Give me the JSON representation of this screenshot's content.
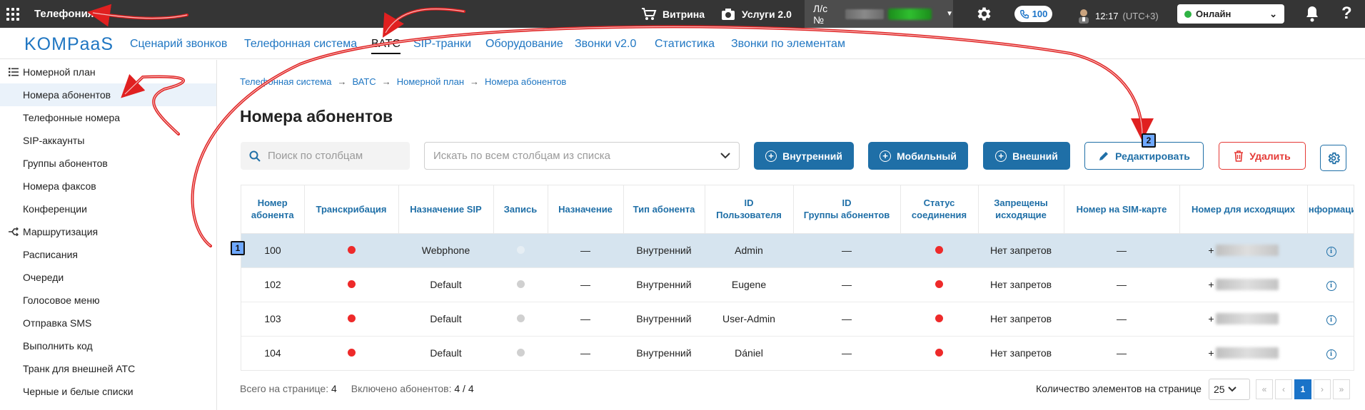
{
  "topbar": {
    "app_title": "Телефония",
    "showcase": "Витрина",
    "services": "Услуги 2.0",
    "account_label": "Л/с №",
    "phone_count": "100",
    "time": "12:17",
    "timezone": "(UTC+3)",
    "status": "Онлайн",
    "help": "?"
  },
  "nav": {
    "logo": "KOMPaaS",
    "tabs": [
      "Сценарий звонков",
      "Телефонная система",
      "ВАТС",
      "SIP-транки",
      "Оборудование",
      "Звонки v2.0",
      "Статистика",
      "Звонки по элементам"
    ]
  },
  "sidebar": {
    "items": [
      "Номерной план",
      "Номера абонентов",
      "Телефонные номера",
      "SIP-аккаунты",
      "Группы абонентов",
      "Номера факсов",
      "Конференции",
      "Маршрутизация",
      "Расписания",
      "Очереди",
      "Голосовое меню",
      "Отправка SMS",
      "Выполнить код",
      "Транк для внешней АТС",
      "Черные и белые списки"
    ]
  },
  "breadcrumb": [
    "Телефонная система",
    "ВАТС",
    "Номерной план",
    "Номера абонентов"
  ],
  "page_title": "Номера абонентов",
  "search": {
    "small_placeholder": "Поиск по столбцам",
    "big_placeholder": "Искать по всем столбцам из списка"
  },
  "buttons": {
    "internal": "Внутренний",
    "mobile": "Мобильный",
    "external": "Внешний",
    "edit": "Редактировать",
    "delete": "Удалить"
  },
  "table": {
    "headers": [
      "Номер абонента",
      "Транскрибация",
      "Назначение SIP",
      "Запись",
      "Назначение",
      "Тип абонента",
      "ID Пользователя",
      "ID Группы абонентов",
      "Статус соединения",
      "Запрещены исходящие",
      "Номер на SIM-карте",
      "Номер для исходящих",
      "Информация"
    ],
    "rows": [
      {
        "number": "100",
        "sip": "Webphone",
        "dest": "—",
        "type": "Внутренний",
        "user": "Admin",
        "group": "—",
        "restrict": "Нет запретов",
        "sim": "—",
        "out_prefix": "+"
      },
      {
        "number": "102",
        "sip": "Default",
        "dest": "—",
        "type": "Внутренний",
        "user": "Eugene",
        "group": "—",
        "restrict": "Нет запретов",
        "sim": "—",
        "out_prefix": "+"
      },
      {
        "number": "103",
        "sip": "Default",
        "dest": "—",
        "type": "Внутренний",
        "user": "User-Admin",
        "group": "—",
        "restrict": "Нет запретов",
        "sim": "—",
        "out_prefix": "+"
      },
      {
        "number": "104",
        "sip": "Default",
        "dest": "—",
        "type": "Внутренний",
        "user": "Dániel",
        "group": "—",
        "restrict": "Нет запретов",
        "sim": "—",
        "out_prefix": "+"
      }
    ]
  },
  "footer": {
    "on_page_label": "Всего на странице:",
    "on_page_value": "4",
    "included_label": "Включено абонентов:",
    "included_value": "4 / 4",
    "per_page_label": "Количество элементов на странице",
    "per_page_value": "25",
    "pager": [
      "«",
      "‹",
      "1",
      "›",
      "»"
    ]
  },
  "annotations": {
    "badge1": "1",
    "badge2": "2"
  },
  "colors": {
    "accent": "#1f6fa7",
    "topbar": "#353535",
    "danger": "#e53935",
    "annotation_arrow": "#e02020"
  }
}
